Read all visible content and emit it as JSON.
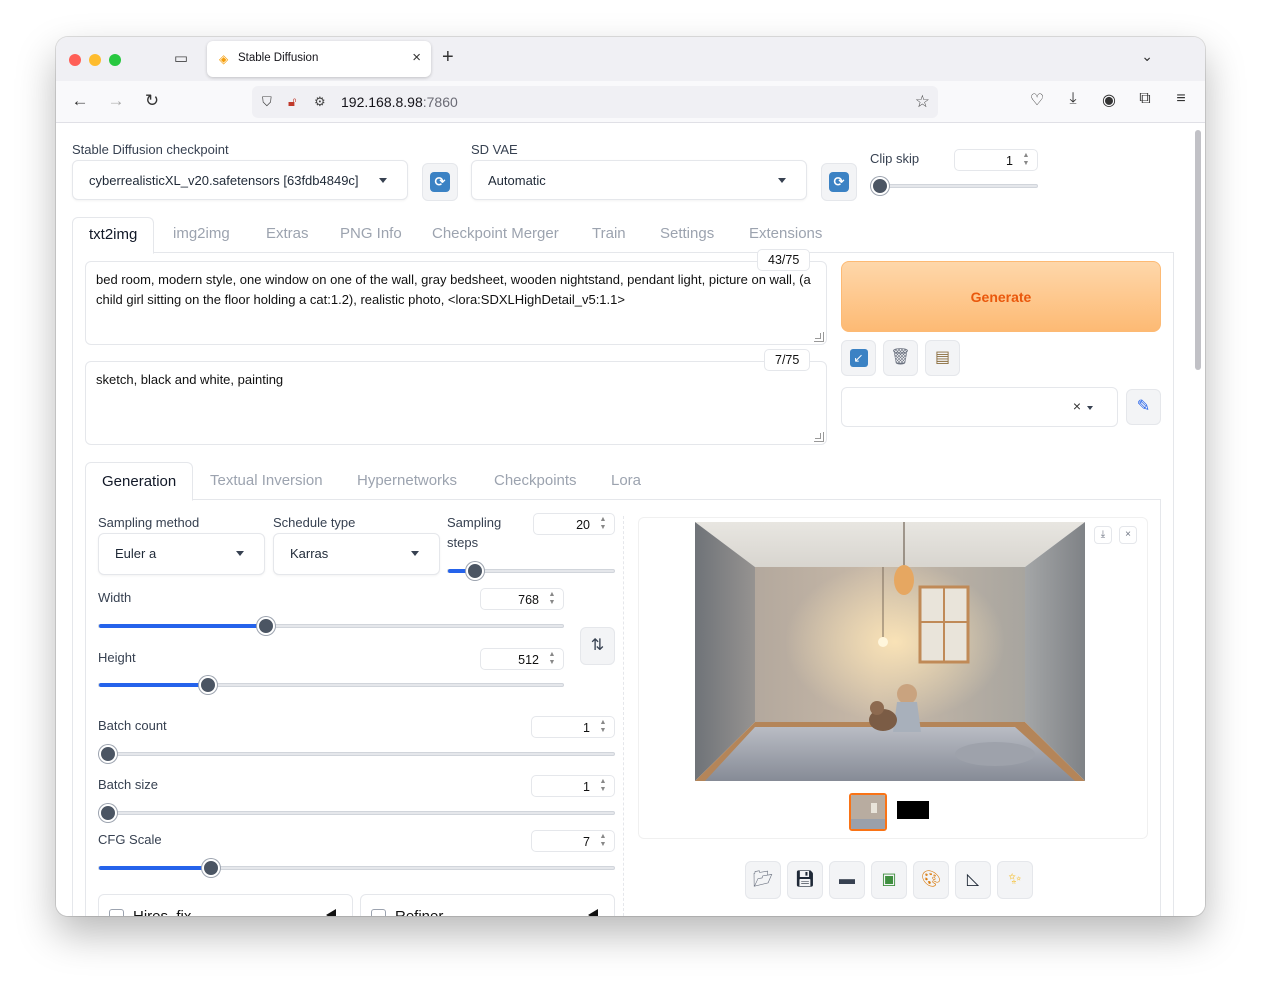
{
  "browser": {
    "tab_title": "Stable Diffusion",
    "url_host": "192.168.8.98",
    "url_port": ":7860"
  },
  "top": {
    "checkpoint_label": "Stable Diffusion checkpoint",
    "checkpoint_value": "cyberrealisticXL_v20.safetensors [63fdb4849c]",
    "vae_label": "SD VAE",
    "vae_value": "Automatic",
    "clip_skip_label": "Clip skip",
    "clip_skip_value": 1
  },
  "main_tabs": [
    "txt2img",
    "img2img",
    "Extras",
    "PNG Info",
    "Checkpoint Merger",
    "Train",
    "Settings",
    "Extensions"
  ],
  "prompt": {
    "positive": "bed room, modern style, one window on one of the wall, gray bedsheet, wooden nightstand, pendant light, picture on wall, (a child girl sitting on the floor holding a cat:1.2), realistic photo, <lora:SDXLHighDetail_v5:1.1>",
    "positive_counter": "43/75",
    "negative": "sketch, black and white, painting",
    "negative_counter": "7/75"
  },
  "generate_label": "Generate",
  "sub_tabs": [
    "Generation",
    "Textual Inversion",
    "Hypernetworks",
    "Checkpoints",
    "Lora"
  ],
  "generation": {
    "sampling_method_label": "Sampling method",
    "sampling_method_value": "Euler a",
    "schedule_type_label": "Schedule type",
    "schedule_type_value": "Karras",
    "sampling_steps_label_1": "Sampling",
    "sampling_steps_label_2": "steps",
    "sampling_steps_value": 20,
    "width_label": "Width",
    "width_value": 768,
    "height_label": "Height",
    "height_value": 512,
    "batch_count_label": "Batch count",
    "batch_count_value": 1,
    "batch_size_label": "Batch size",
    "batch_size_value": 1,
    "cfg_scale_label": "CFG Scale",
    "cfg_scale_value": 7,
    "hires_fix_label": "Hires. fix",
    "refiner_label": "Refiner"
  },
  "colors": {
    "accent": "#2563eb",
    "generate_bg": "#fdba74",
    "generate_text": "#ea580c",
    "thumb_selected": "#f97316"
  },
  "icons": {
    "refresh": "refresh-icon",
    "paste": "arrow-paste-icon",
    "trash": "trash-icon",
    "clipboard": "clipboard-icon",
    "edit": "pencil-icon",
    "swap": "swap-vertical-icon",
    "folder": "folder-icon",
    "save": "floppy-disk-icon",
    "zip": "archive-icon",
    "send_img2img": "picture-icon",
    "send_inpaint": "palette-icon",
    "send_extras": "triangle-ruler-icon",
    "sparkle": "sparkle-icon"
  }
}
